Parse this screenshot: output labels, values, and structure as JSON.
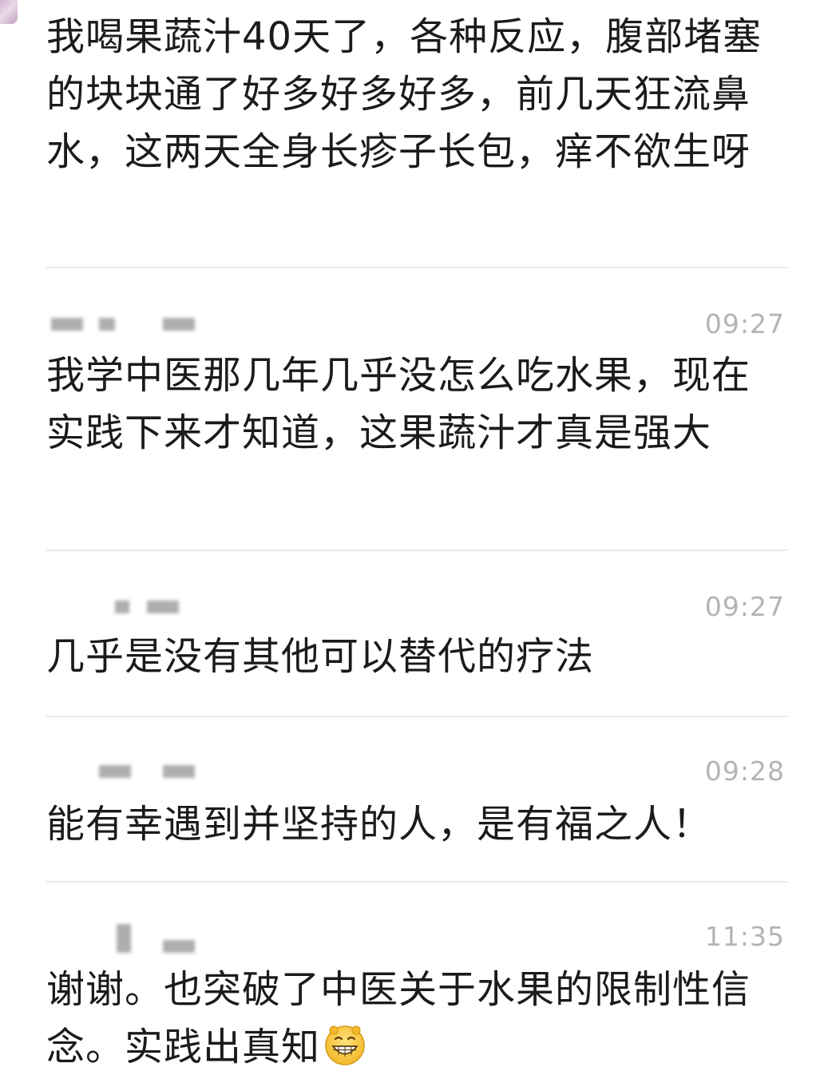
{
  "comments": [
    {
      "body": "我喝果蔬汁40天了，各种反应，腹部堵塞的块块通了好多好多好多，前几天狂流鼻水，这两天全身长疹子长包，痒不欲生呀"
    },
    {
      "time": "09:27",
      "body": "我学中医那几年几乎没怎么吃水果，现在实践下来才知道，这果蔬汁才真是强大"
    },
    {
      "time": "09:27",
      "body": "几乎是没有其他可以替代的疗法"
    },
    {
      "time": "09:28",
      "body": "能有幸遇到并坚持的人，是有福之人！"
    },
    {
      "time": "11:35",
      "body": "谢谢。也突破了中医关于水果的限制性信念。实践出真知",
      "emoji": "grinning-face-emoji"
    }
  ]
}
